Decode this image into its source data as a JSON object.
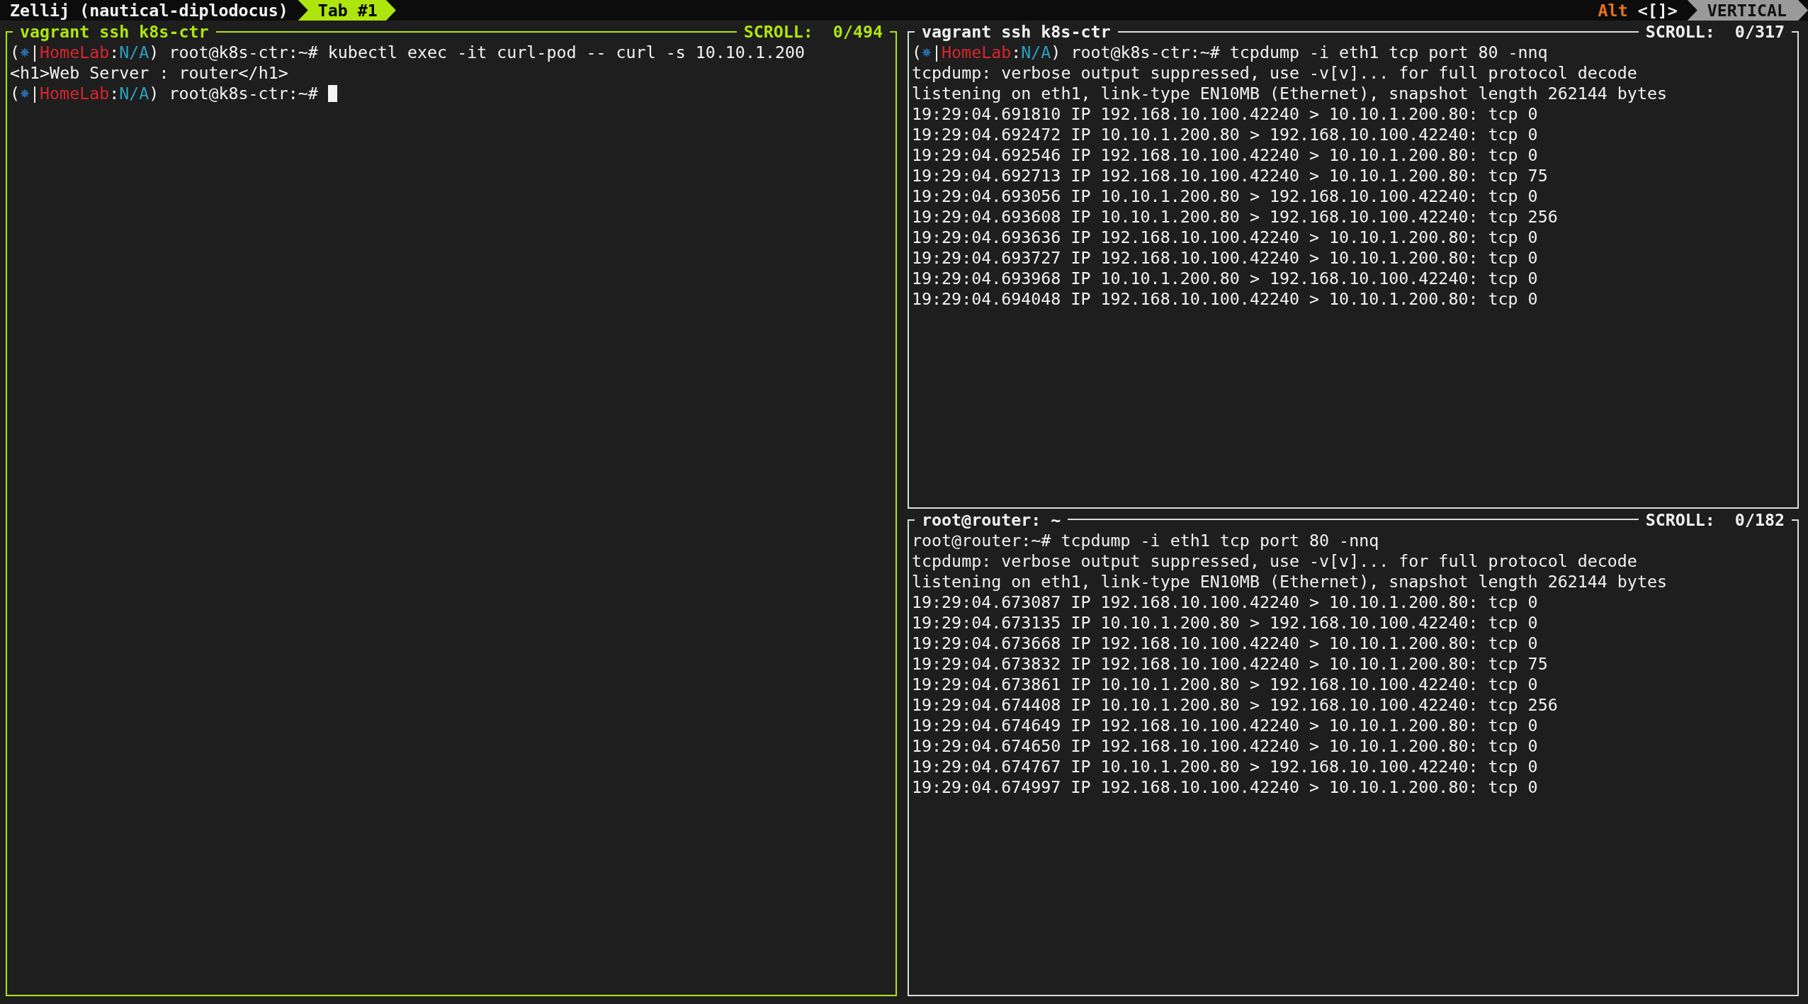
{
  "top_bar": {
    "session": "Zellij (nautical-diplodocus)",
    "tabs": [
      {
        "label": "Tab #1",
        "selected": true
      }
    ],
    "modifier": "Alt",
    "mode_keys": "<[]>",
    "mode": "VERTICAL"
  },
  "panes": [
    {
      "title": "vagrant ssh k8s-ctr",
      "scroll": "SCROLL:  0/494",
      "focused": true,
      "lines": [
        {
          "kind": "prompt",
          "open": "(",
          "bar": "|",
          "context": "HomeLab",
          "sep": ":",
          "namespace": "N/A",
          "close": ")",
          "text": "root@k8s-ctr:~# kubectl exec -it curl-pod -- curl -s 10.10.1.200",
          "cursor": false
        },
        {
          "kind": "output",
          "text": "<h1>Web Server : router</h1>"
        },
        {
          "kind": "prompt",
          "open": "(",
          "bar": "|",
          "context": "HomeLab",
          "sep": ":",
          "namespace": "N/A",
          "close": ")",
          "text": "root@k8s-ctr:~# ",
          "cursor": true
        }
      ]
    },
    {
      "title": "vagrant ssh k8s-ctr",
      "scroll": "SCROLL:  0/317",
      "focused": false,
      "lines": [
        {
          "kind": "prompt",
          "open": "(",
          "bar": "|",
          "context": "HomeLab",
          "sep": ":",
          "namespace": "N/A",
          "close": ")",
          "text": "root@k8s-ctr:~# tcpdump -i eth1 tcp port 80 -nnq",
          "cursor": false
        },
        {
          "kind": "output",
          "text": "tcpdump: verbose output suppressed, use -v[v]... for full protocol decode"
        },
        {
          "kind": "output",
          "text": "listening on eth1, link-type EN10MB (Ethernet), snapshot length 262144 bytes"
        },
        {
          "kind": "output",
          "text": "19:29:04.691810 IP 192.168.10.100.42240 > 10.10.1.200.80: tcp 0"
        },
        {
          "kind": "output",
          "text": "19:29:04.692472 IP 10.10.1.200.80 > 192.168.10.100.42240: tcp 0"
        },
        {
          "kind": "output",
          "text": "19:29:04.692546 IP 192.168.10.100.42240 > 10.10.1.200.80: tcp 0"
        },
        {
          "kind": "output",
          "text": "19:29:04.692713 IP 192.168.10.100.42240 > 10.10.1.200.80: tcp 75"
        },
        {
          "kind": "output",
          "text": "19:29:04.693056 IP 10.10.1.200.80 > 192.168.10.100.42240: tcp 0"
        },
        {
          "kind": "output",
          "text": "19:29:04.693608 IP 10.10.1.200.80 > 192.168.10.100.42240: tcp 256"
        },
        {
          "kind": "output",
          "text": "19:29:04.693636 IP 192.168.10.100.42240 > 10.10.1.200.80: tcp 0"
        },
        {
          "kind": "output",
          "text": "19:29:04.693727 IP 192.168.10.100.42240 > 10.10.1.200.80: tcp 0"
        },
        {
          "kind": "output",
          "text": "19:29:04.693968 IP 10.10.1.200.80 > 192.168.10.100.42240: tcp 0"
        },
        {
          "kind": "output",
          "text": "19:29:04.694048 IP 192.168.10.100.42240 > 10.10.1.200.80: tcp 0"
        }
      ]
    },
    {
      "title": "root@router: ~",
      "scroll": "SCROLL:  0/182",
      "focused": false,
      "lines": [
        {
          "kind": "output",
          "text": "root@router:~# tcpdump -i eth1 tcp port 80 -nnq"
        },
        {
          "kind": "output",
          "text": "tcpdump: verbose output suppressed, use -v[v]... for full protocol decode"
        },
        {
          "kind": "output",
          "text": "listening on eth1, link-type EN10MB (Ethernet), snapshot length 262144 bytes"
        },
        {
          "kind": "output",
          "text": "19:29:04.673087 IP 192.168.10.100.42240 > 10.10.1.200.80: tcp 0"
        },
        {
          "kind": "output",
          "text": "19:29:04.673135 IP 10.10.1.200.80 > 192.168.10.100.42240: tcp 0"
        },
        {
          "kind": "output",
          "text": "19:29:04.673668 IP 192.168.10.100.42240 > 10.10.1.200.80: tcp 0"
        },
        {
          "kind": "output",
          "text": "19:29:04.673832 IP 192.168.10.100.42240 > 10.10.1.200.80: tcp 75"
        },
        {
          "kind": "output",
          "text": "19:29:04.673861 IP 10.10.1.200.80 > 192.168.10.100.42240: tcp 0"
        },
        {
          "kind": "output",
          "text": "19:29:04.674408 IP 10.10.1.200.80 > 192.168.10.100.42240: tcp 256"
        },
        {
          "kind": "output",
          "text": "19:29:04.674649 IP 192.168.10.100.42240 > 10.10.1.200.80: tcp 0"
        },
        {
          "kind": "output",
          "text": "19:29:04.674650 IP 192.168.10.100.42240 > 10.10.1.200.80: tcp 0"
        },
        {
          "kind": "output",
          "text": "19:29:04.674767 IP 10.10.1.200.80 > 192.168.10.100.42240: tcp 0"
        },
        {
          "kind": "output",
          "text": "19:29:04.674997 IP 192.168.10.100.42240 > 10.10.1.200.80: tcp 0"
        }
      ]
    }
  ]
}
